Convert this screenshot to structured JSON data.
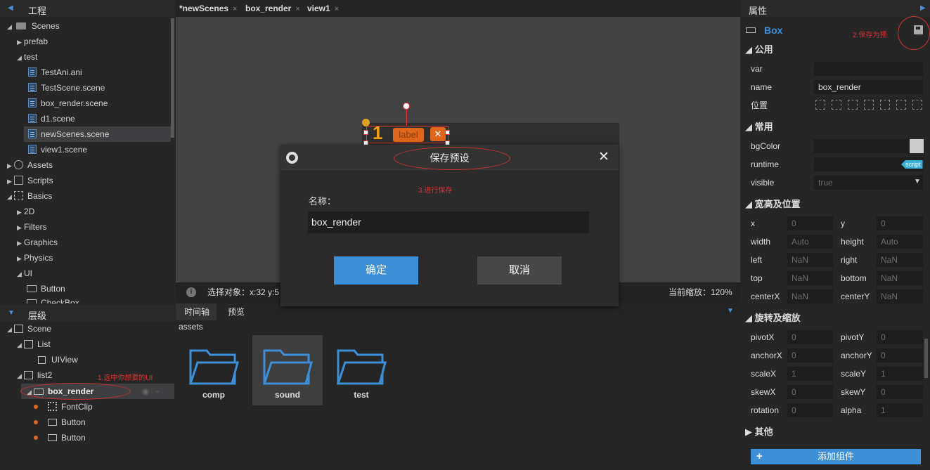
{
  "project": {
    "title": "工程",
    "items": [
      {
        "label": "Scenes",
        "expanded": true,
        "icon": "folder-icon"
      },
      {
        "label": "prefab",
        "expanded": false
      },
      {
        "label": "test",
        "expanded": true
      },
      {
        "label": "TestAni.ani"
      },
      {
        "label": "TestScene.scene"
      },
      {
        "label": "box_render.scene"
      },
      {
        "label": "d1.scene"
      },
      {
        "label": "newScenes.scene",
        "selected": true
      },
      {
        "label": "view1.scene"
      },
      {
        "label": "Assets"
      },
      {
        "label": "Scripts"
      },
      {
        "label": "Basics"
      },
      {
        "label": "2D"
      },
      {
        "label": "Filters"
      },
      {
        "label": "Graphics"
      },
      {
        "label": "Physics"
      },
      {
        "label": "UI"
      },
      {
        "label": "Button"
      },
      {
        "label": "CheckBox"
      }
    ]
  },
  "hierarchy": {
    "title": "层级",
    "items": [
      {
        "label": "Scene"
      },
      {
        "label": "List"
      },
      {
        "label": "UIView"
      },
      {
        "label": "list2"
      },
      {
        "label": "box_render",
        "selected": true
      },
      {
        "label": "FontClip"
      },
      {
        "label": "Button"
      },
      {
        "label": "Button"
      }
    ],
    "annotation": "1.选中你想要的UI"
  },
  "tabs": [
    {
      "label": "*newScenes",
      "close": "×"
    },
    {
      "label": "box_render",
      "close": "×"
    },
    {
      "label": "view1",
      "close": "×"
    }
  ],
  "canvas": {
    "widget_num": "1",
    "widget_label": "label",
    "widget_close": "✕"
  },
  "status": {
    "select_text": "选择对象：x:32 y:5",
    "zoom_text": "当前缩放：120%"
  },
  "bottom": {
    "tabs": [
      {
        "label": "时间轴"
      },
      {
        "label": "预览"
      }
    ],
    "path": "assets",
    "folders": [
      {
        "label": "comp"
      },
      {
        "label": "sound",
        "selected": true
      },
      {
        "label": "test"
      }
    ]
  },
  "dialog": {
    "title": "保存预设",
    "annotation": "3.进行保存",
    "name_label": "名称：",
    "name_value": "box_render",
    "ok": "确定",
    "cancel": "取消",
    "close": "✕"
  },
  "props": {
    "title": "属性",
    "component": "Box",
    "annotation": "2.保存为预",
    "sections": {
      "common": "公用",
      "usual": "常用",
      "size": "宽高及位置",
      "rotate": "旋转及缩放",
      "other": "其他"
    },
    "var_label": "var",
    "var_value": "",
    "name_label": "name",
    "name_value": "box_render",
    "pos_label": "位置",
    "bgcolor_label": "bgColor",
    "runtime_label": "runtime",
    "runtime_tag": "script",
    "visible_label": "visible",
    "visible_value": "true",
    "x": "x",
    "x_val": "0",
    "y": "y",
    "y_val": "0",
    "width": "width",
    "width_val": "Auto",
    "height": "height",
    "height_val": "Auto",
    "left": "left",
    "left_val": "NaN",
    "right": "right",
    "right_val": "NaN",
    "top": "top",
    "top_val": "NaN",
    "bottom": "bottom",
    "bottom_val": "NaN",
    "centerX": "centerX",
    "centerX_val": "NaN",
    "centerY": "centerY",
    "centerY_val": "NaN",
    "pivotX": "pivotX",
    "pivotX_val": "0",
    "pivotY": "pivotY",
    "pivotY_val": "0",
    "anchorX": "anchorX",
    "anchorX_val": "0",
    "anchorY": "anchorY",
    "anchorY_val": "0",
    "scaleX": "scaleX",
    "scaleX_val": "1",
    "scaleY": "scaleY",
    "scaleY_val": "1",
    "skewX": "skewX",
    "skewX_val": "0",
    "skewY": "skewY",
    "skewY_val": "0",
    "rotation": "rotation",
    "rotation_val": "0",
    "alpha": "alpha",
    "alpha_val": "1",
    "add_component": "添加组件",
    "add_plus": "+"
  },
  "colors": {
    "accent": "#3d8fd8",
    "annotation": "#d03030",
    "orange": "#e0661c"
  }
}
